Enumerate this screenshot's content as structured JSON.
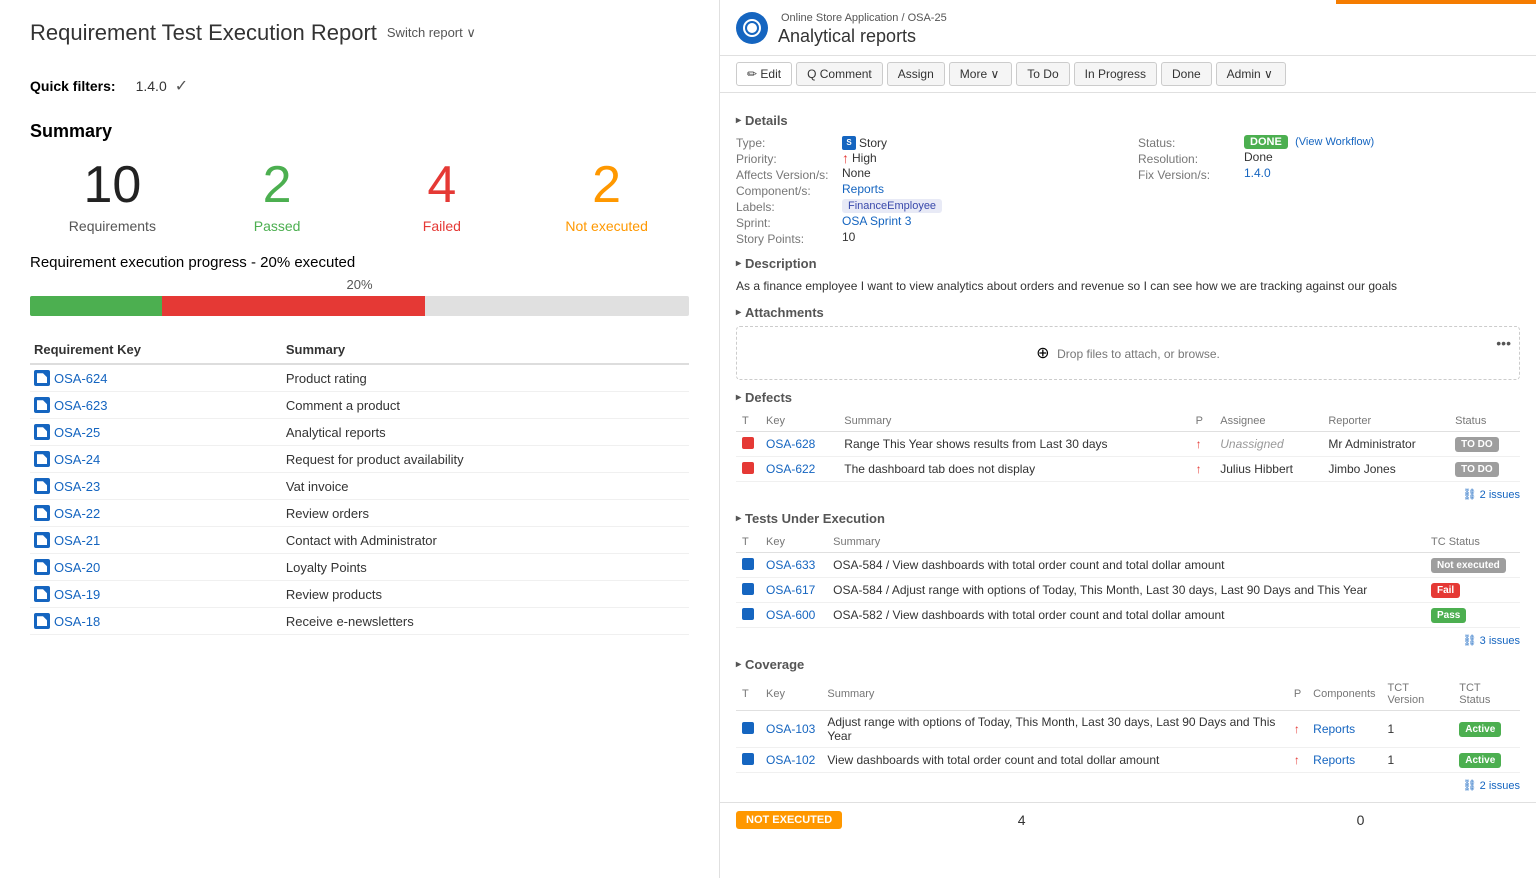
{
  "left": {
    "report_title": "Requirement Test Execution Report",
    "switch_report_label": "Switch report ∨",
    "quick_filters_label": "Quick filters:",
    "filter_value": "1.4.0",
    "summary_title": "Summary",
    "stats": [
      {
        "number": "10",
        "label": "Requirements",
        "color": "black"
      },
      {
        "number": "2",
        "label": "Passed",
        "color": "green"
      },
      {
        "number": "4",
        "label": "Failed",
        "color": "red"
      },
      {
        "number": "2",
        "label": "Not executed",
        "color": "orange"
      }
    ],
    "progress_title": "Requirement execution progress",
    "progress_subtitle": "- 20% executed",
    "progress_percent": "20%",
    "table_headers": [
      "Requirement Key",
      "Summary"
    ],
    "requirements": [
      {
        "key": "OSA-624",
        "summary": "Product rating"
      },
      {
        "key": "OSA-623",
        "summary": "Comment a product"
      },
      {
        "key": "OSA-25",
        "summary": "Analytical reports"
      },
      {
        "key": "OSA-24",
        "summary": "Request for product availability"
      },
      {
        "key": "OSA-23",
        "summary": "Vat invoice"
      },
      {
        "key": "OSA-22",
        "summary": "Review orders"
      },
      {
        "key": "OSA-21",
        "summary": "Contact with Administrator"
      },
      {
        "key": "OSA-20",
        "summary": "Loyalty Points"
      },
      {
        "key": "OSA-19",
        "summary": "Review products"
      },
      {
        "key": "OSA-18",
        "summary": "Receive e-newsletters"
      }
    ]
  },
  "right": {
    "orange_bar": true,
    "breadcrumb": "Online Store Application / OSA-25",
    "issue_title": "Analytical reports",
    "toolbar": {
      "edit": "✏ Edit",
      "comment": "Q Comment",
      "assign": "Assign",
      "more": "More ∨",
      "todo": "To Do",
      "in_progress": "In Progress",
      "done": "Done",
      "admin": "Admin ∨"
    },
    "details": {
      "section_label": "Details",
      "type_label": "Type:",
      "type_value": "Story",
      "priority_label": "Priority:",
      "priority_value": "High",
      "affects_label": "Affects Version/s:",
      "affects_value": "None",
      "component_label": "Component/s:",
      "component_value": "Reports",
      "labels_label": "Labels:",
      "labels_value": "FinanceEmployee",
      "sprint_label": "Sprint:",
      "sprint_value": "OSA Sprint 3",
      "story_points_label": "Story Points:",
      "story_points_value": "10",
      "status_label": "Status:",
      "status_value": "DONE",
      "view_workflow": "(View Workflow)",
      "resolution_label": "Resolution:",
      "resolution_value": "Done",
      "fix_version_label": "Fix Version/s:",
      "fix_version_value": "1.4.0"
    },
    "description": {
      "section_label": "Description",
      "text": "As a finance employee I want to view analytics about orders and revenue so I can see how we are tracking against our goals"
    },
    "attachments": {
      "section_label": "Attachments",
      "drop_text": "Drop files to attach, or browse."
    },
    "defects": {
      "section_label": "Defects",
      "headers": [
        "T",
        "Key",
        "Summary",
        "P",
        "Assignee",
        "Reporter",
        "Status"
      ],
      "rows": [
        {
          "type": "red",
          "key": "OSA-628",
          "summary": "Range This Year shows results from Last 30 days",
          "priority": "↑",
          "assignee": "Unassigned",
          "reporter": "Mr Administrator",
          "status": "TO DO"
        },
        {
          "type": "red",
          "key": "OSA-622",
          "summary": "The dashboard tab does not display",
          "priority": "↑",
          "assignee": "Julius Hibbert",
          "reporter": "Jimbo Jones",
          "status": "TO DO"
        }
      ],
      "issues_link": "⛓ 2 issues"
    },
    "tests": {
      "section_label": "Tests Under Execution",
      "headers": [
        "T",
        "Key",
        "Summary",
        "TC Status"
      ],
      "rows": [
        {
          "type": "blue",
          "key": "OSA-633",
          "summary": "OSA-584 / View dashboards with total order count and total dollar amount",
          "status": "Not executed",
          "status_class": "status-not-exec-gray"
        },
        {
          "type": "blue",
          "key": "OSA-617",
          "summary": "OSA-584 / Adjust range with options of Today, This Month, Last 30 days, Last 90 Days and This Year",
          "status": "Fail",
          "status_class": "status-fail"
        },
        {
          "type": "blue",
          "key": "OSA-600",
          "summary": "OSA-582 / View dashboards with total order count and total dollar amount",
          "status": "Pass",
          "status_class": "status-pass"
        }
      ],
      "issues_link": "⛓ 3 issues"
    },
    "coverage": {
      "section_label": "Coverage",
      "headers": [
        "T",
        "Key",
        "Summary",
        "P",
        "Components",
        "TCT Version",
        "TCT Status"
      ],
      "rows": [
        {
          "type": "blue",
          "key": "OSA-103",
          "summary": "Adjust range with options of Today, This Month, Last 30 days, Last 90 Days and This Year",
          "priority": "↑",
          "components": "Reports",
          "tct_version": "1",
          "tct_status": "Active",
          "status_class": "status-active"
        },
        {
          "type": "blue",
          "key": "OSA-102",
          "summary": "View dashboards with total order count and total dollar amount",
          "priority": "↑",
          "components": "Reports",
          "tct_version": "1",
          "tct_status": "Active",
          "status_class": "status-active"
        }
      ],
      "issues_link": "⛓ 2 issues"
    },
    "bottom_bar": {
      "not_executed_badge": "NOT EXECUTED",
      "number1": "4",
      "number2": "0"
    }
  }
}
